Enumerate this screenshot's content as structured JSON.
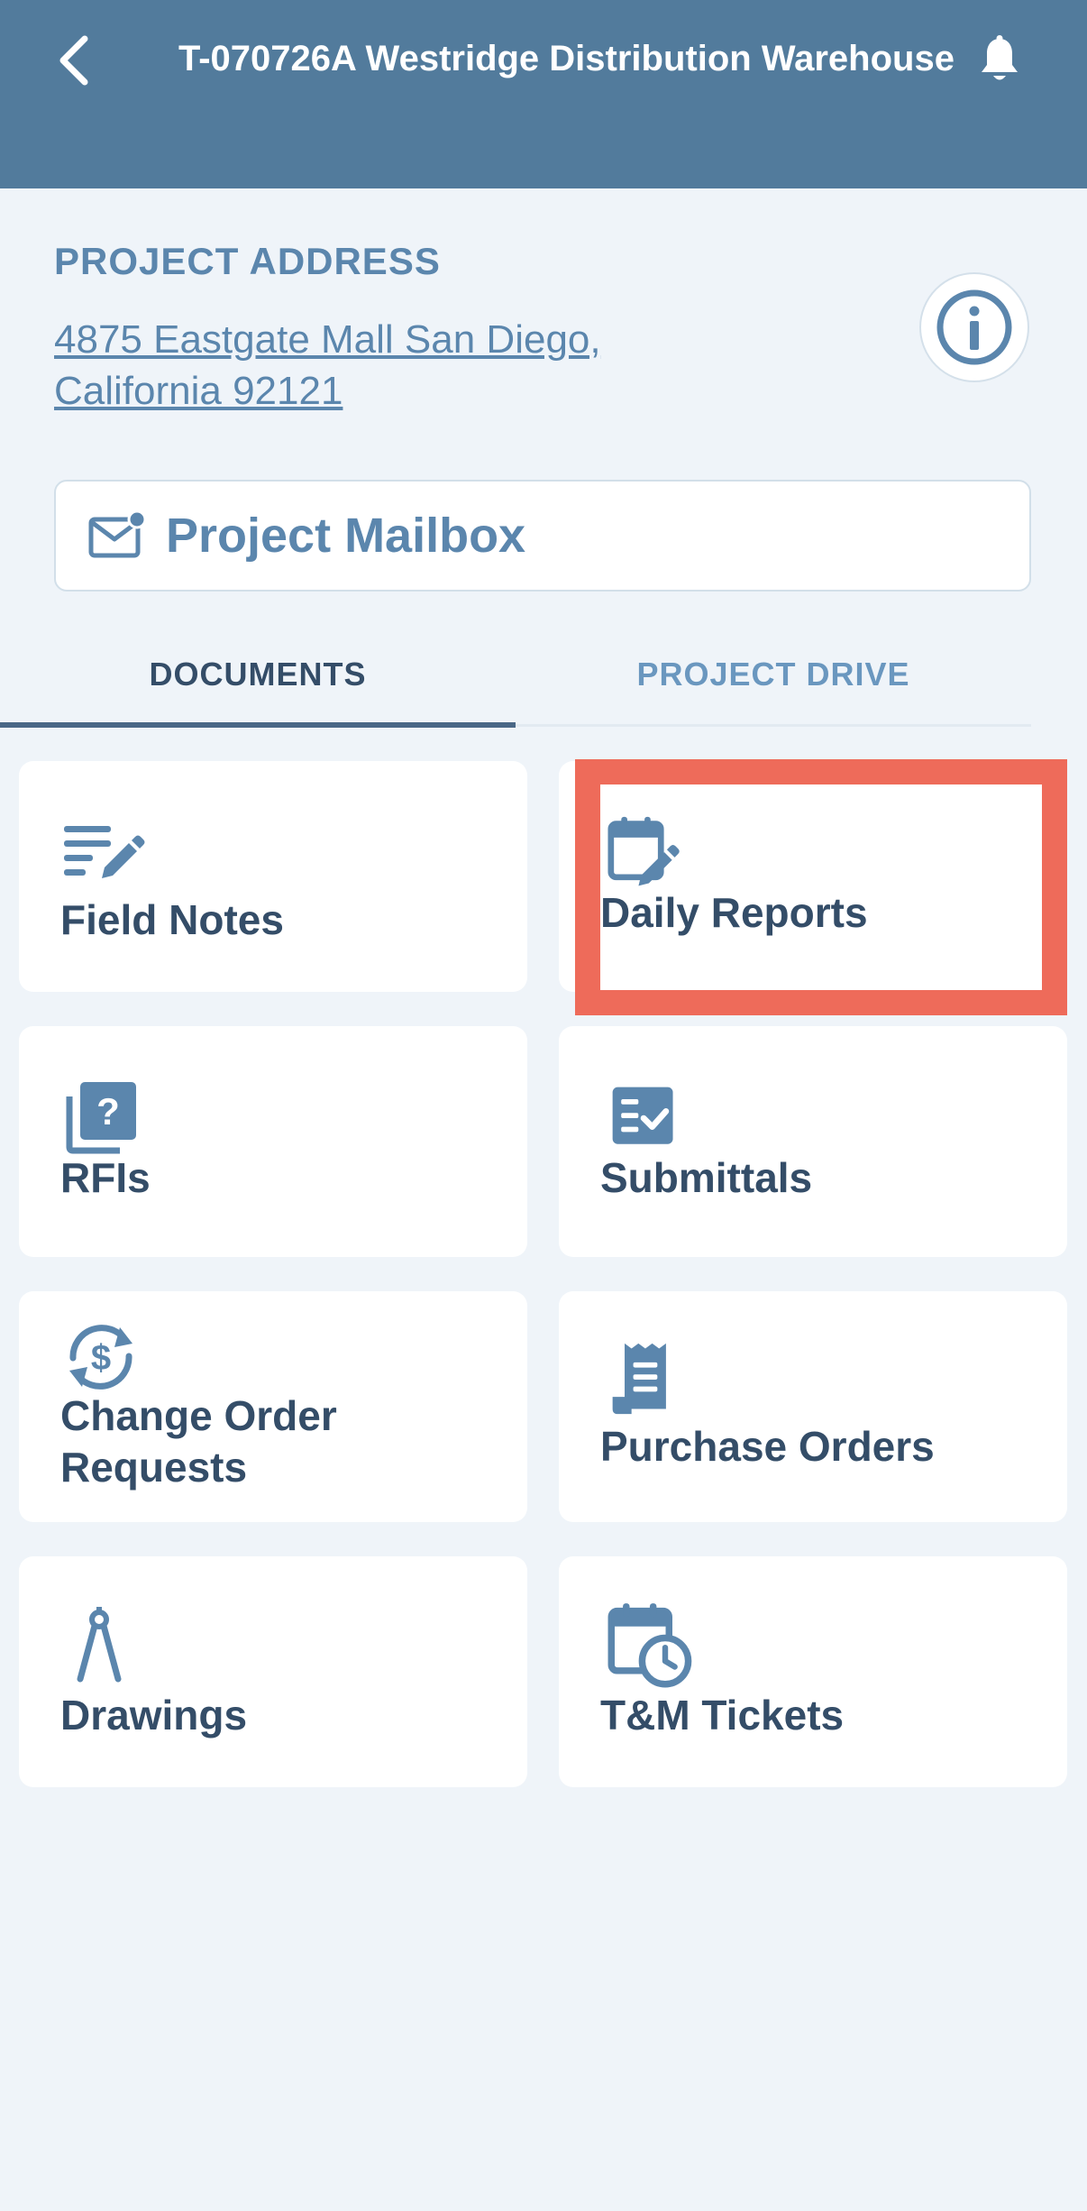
{
  "header": {
    "title": "T-070726A Westridge Distribution Warehouse",
    "back_icon": "chevron-left-icon",
    "bell_icon": "bell-icon",
    "background_color": "#527b9c"
  },
  "project": {
    "address_label": "PROJECT ADDRESS",
    "address_line1": "4875 Eastgate Mall  San Diego,",
    "address_line2": "California 92121",
    "info_icon": "info-icon"
  },
  "mailbox": {
    "label": "Project Mailbox",
    "icon": "mail-icon"
  },
  "tabs": [
    {
      "label": "DOCUMENTS",
      "active": true
    },
    {
      "label": "PROJECT DRIVE",
      "active": false
    }
  ],
  "documents": [
    {
      "label": "Field Notes",
      "icon": "notes-pencil-icon"
    },
    {
      "label": "Daily Reports",
      "icon": "calendar-edit-icon",
      "highlighted": true
    },
    {
      "label": "RFIs",
      "icon": "question-docs-icon"
    },
    {
      "label": "Submittals",
      "icon": "checklist-icon"
    },
    {
      "label": "Change Order Requests",
      "label_line1": "Change Order",
      "label_line2": "Requests",
      "icon": "dollar-refresh-icon"
    },
    {
      "label": "Purchase Orders",
      "icon": "receipt-icon"
    },
    {
      "label": "Drawings",
      "icon": "compass-icon"
    },
    {
      "label": "T&M Tickets",
      "icon": "calendar-clock-icon"
    }
  ],
  "colors": {
    "accent": "#5b86ad",
    "text_dark": "#344d68",
    "highlight": "#ee6b5a",
    "background": "#eff4f9"
  }
}
